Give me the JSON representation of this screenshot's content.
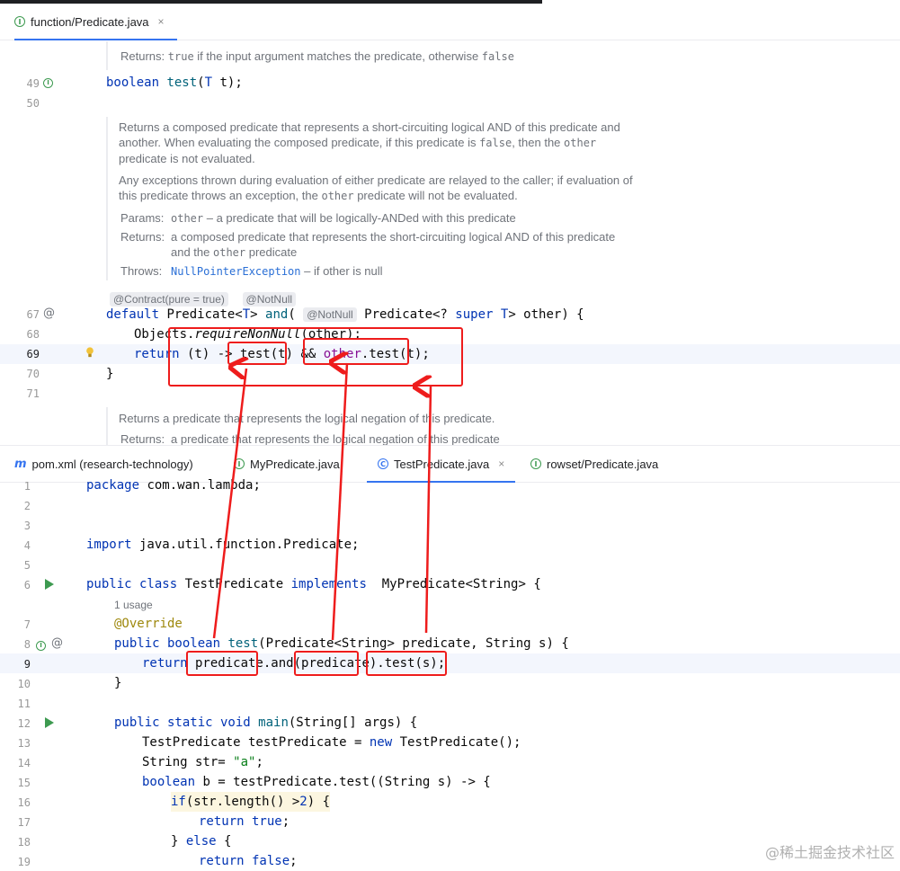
{
  "top_tab": {
    "label": "function/Predicate.java",
    "icon": "interface-icon",
    "close": "×"
  },
  "top_editor": {
    "doc0": {
      "label": "Returns:",
      "value_code": "true",
      "value_mid": " if the input argument matches the predicate, otherwise ",
      "value_code2": "false"
    },
    "line_numbers": {
      "n49": "49",
      "n50": "50",
      "n67": "67",
      "n68": "68",
      "n69": "69",
      "n70": "70",
      "n71": "71"
    },
    "doc1": {
      "p1a": "Returns a composed predicate that represents a short-circuiting logical AND of this predicate and",
      "p1b_pre": "another. When evaluating the composed predicate, if this predicate is ",
      "p1b_code": "false",
      "p1b_mid": ", then the ",
      "p1b_code2": "other",
      "p1c": "predicate is not evaluated.",
      "p2a": "Any exceptions thrown during evaluation of either predicate are relayed to the caller; if evaluation of",
      "p2b_pre": "this predicate throws an exception, the ",
      "p2b_code": "other",
      "p2b_post": " predicate will not be evaluated.",
      "params_label": "Params:",
      "params_code": "other",
      "params_text": " – a predicate that will be logically-ANDed with this predicate",
      "returns_label": "Returns:",
      "returns_text1": "a composed predicate that represents the short-circuiting logical AND of this predicate",
      "returns_text2_pre": "and the ",
      "returns_code": "other",
      "returns_text2_post": " predicate",
      "throws_label": "Throws:",
      "throws_link": "NullPointerException",
      "throws_text": " – if other is null"
    },
    "inlays": {
      "contract": "@Contract(pure = true)",
      "notnull": "@NotNull",
      "notnull2": "@NotNull"
    },
    "doc2": {
      "p1": "Returns a predicate that represents the logical negation of this predicate.",
      "returns_label": "Returns:",
      "returns_text": "a predicate that represents the logical negation of this predicate"
    }
  },
  "bottom_tabs": [
    {
      "label": "pom.xml (research-technology)",
      "icon": "maven-icon"
    },
    {
      "label": "MyPredicate.java",
      "icon": "interface-icon"
    },
    {
      "label": "TestPredicate.java",
      "icon": "class-icon",
      "active": true,
      "close": "×"
    },
    {
      "label": "rowset/Predicate.java",
      "icon": "interface-icon"
    }
  ],
  "bottom_editor": {
    "line_numbers": [
      "1",
      "2",
      "3",
      "4",
      "5",
      "6",
      "7",
      "8",
      "9",
      "10",
      "11",
      "12",
      "13",
      "14",
      "15",
      "16",
      "17",
      "18",
      "19"
    ],
    "usage_hint": "1 usage"
  },
  "watermark": "@稀土掘金技术社区"
}
